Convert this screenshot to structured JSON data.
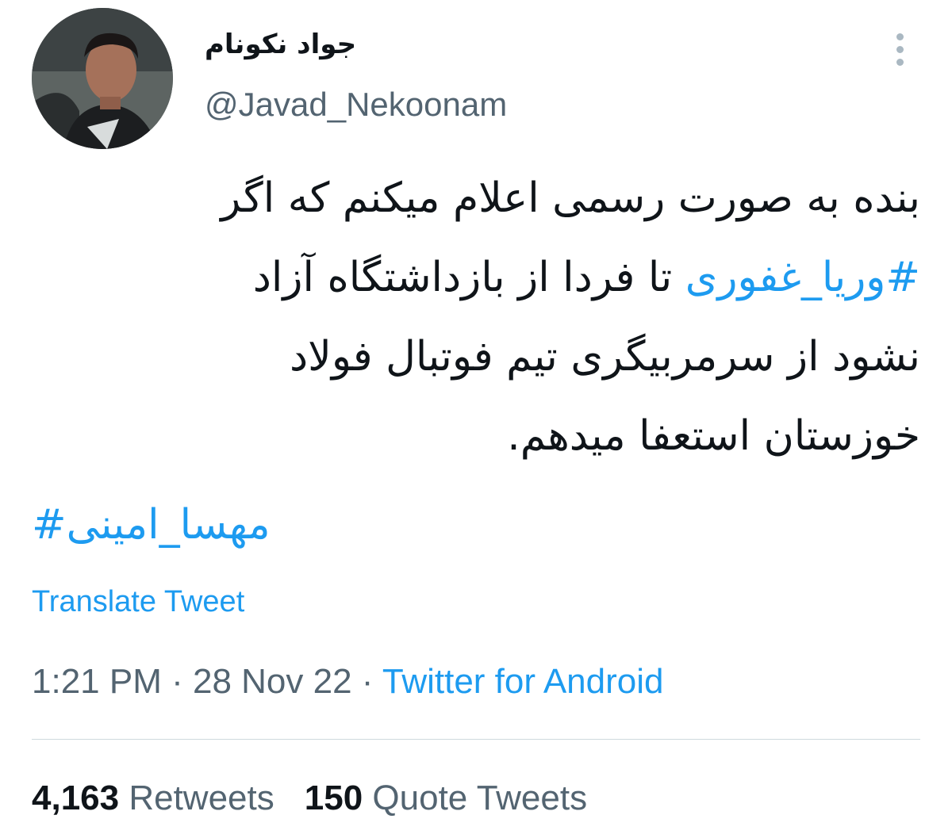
{
  "author": {
    "display_name": "جواد نکونام",
    "handle": "@Javad_Nekoonam"
  },
  "tweet": {
    "line1": "بنده به صورت رسمی اعلام میکنم که اگر",
    "line2_hashtag": "#وریا_غفوری",
    "line2_text": " تا فردا از بازداشتگاه آزاد",
    "line3": "نشود از سرمربیگری تیم فوتبال فولاد",
    "line4": "خوزستان استعفا میدهم.",
    "hashtag2": "مهسا_امینی#"
  },
  "translate_label": "Translate Tweet",
  "meta": {
    "time": "1:21 PM",
    "separator1": " · ",
    "date": "28 Nov 22",
    "separator2": " · ",
    "source": "Twitter for Android"
  },
  "stats": {
    "retweets_count": "4,163",
    "retweets_label": " Retweets",
    "quotes_count": "150",
    "quotes_label": " Quote Tweets"
  },
  "colors": {
    "link": "#1d9bf0",
    "secondary_text": "#536471",
    "primary_text": "#0f1419",
    "divider": "#cfd9de"
  },
  "icons": {
    "more": "more-vertical-icon"
  }
}
